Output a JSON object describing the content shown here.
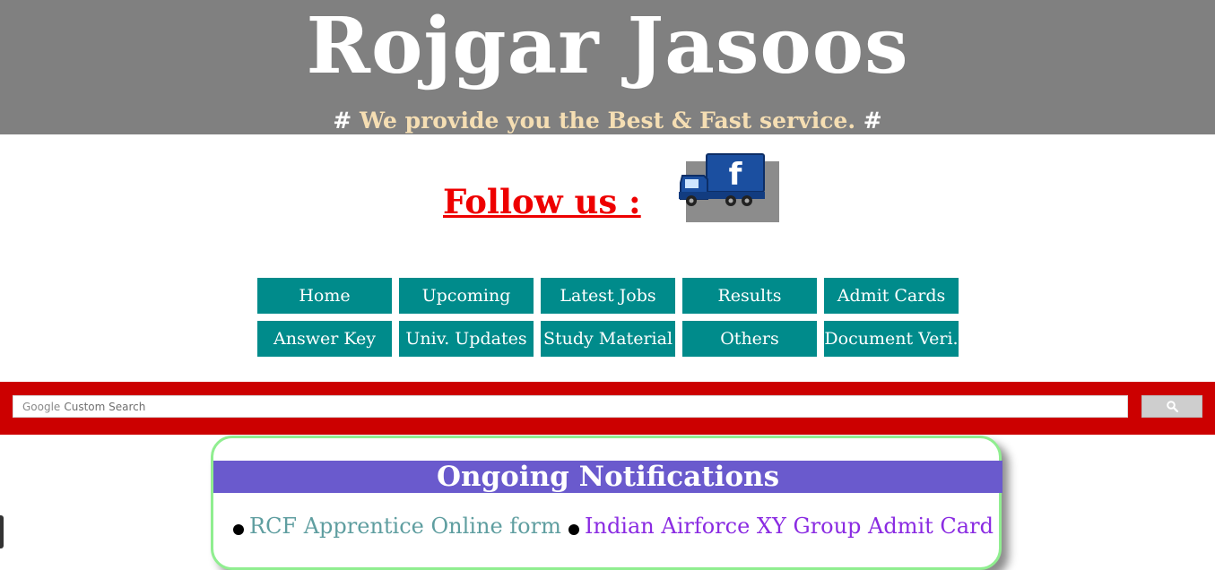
{
  "header": {
    "title": "Rojgar Jasoos",
    "tagline_hash_left": "#",
    "tagline": "We provide you the Best & Fast service.",
    "tagline_hash_right": "#"
  },
  "follow": {
    "label": "Follow us :",
    "icon": "facebook-truck-icon",
    "icon_letter": "f"
  },
  "nav": {
    "row1": [
      "Home",
      "Upcoming",
      "Latest Jobs",
      "Results",
      "Admit Cards"
    ],
    "row2": [
      "Answer Key",
      "Univ. Updates",
      "Study Material",
      "Others",
      "Document Veri."
    ]
  },
  "search": {
    "placeholder_brand": "Google",
    "placeholder": "Custom Search",
    "button_icon": "search-icon"
  },
  "notifications": {
    "title": "Ongoing Notifications",
    "items": [
      {
        "label": "RCF Apprentice Online form",
        "color": "#5f9ea0"
      },
      {
        "label": "Indian Airforce XY Group Admit Card",
        "color": "#8a2be2"
      }
    ]
  },
  "colors": {
    "header_bg": "#808080",
    "tagline": "#f5deb3",
    "follow": "#ee0000",
    "nav_bg": "#008b8b",
    "search_bar": "#cc0000",
    "notice_border": "#90ee90",
    "notice_header": "#6a5acd"
  }
}
